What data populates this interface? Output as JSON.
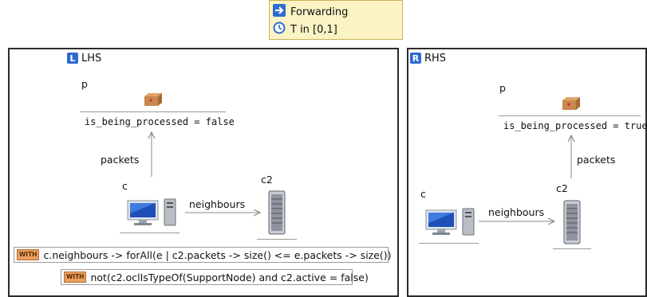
{
  "header": {
    "rule_name": "Forwarding",
    "time_constraint": "T in [0,1]"
  },
  "lhs": {
    "title": "LHS",
    "badge": "L",
    "nodes": {
      "p": {
        "name": "p",
        "attribute": "is_being_processed  = false"
      },
      "c": {
        "name": "c"
      },
      "c2": {
        "name": "c2"
      }
    },
    "edges": {
      "packets": "packets",
      "neighbours": "neighbours"
    },
    "constraints": {
      "badge": "WITH",
      "first": "c.neighbours -> forAll(e | c2.packets  ->  size() <= e.packets  ->  size())",
      "second": "not(c2.oclIsTypeOf(SupportNode) and c2.active = false)"
    }
  },
  "rhs": {
    "title": "RHS",
    "badge": "R",
    "nodes": {
      "p": {
        "name": "p",
        "attribute": "is_being_processed  = true"
      },
      "c": {
        "name": "c"
      },
      "c2": {
        "name": "c2"
      }
    },
    "edges": {
      "packets": "packets",
      "neighbours": "neighbours"
    }
  },
  "icons": {
    "rule": "arrow-right-icon",
    "time": "clock-icon",
    "package": "package-icon",
    "computer": "computer-icon",
    "server": "server-icon"
  },
  "colors": {
    "header_bg": "#fbf3c4",
    "panel_border": "#2b2b2b",
    "badge_blue": "#2f6bd3",
    "with_badge": "#e9a060",
    "package": "#c9894e"
  }
}
